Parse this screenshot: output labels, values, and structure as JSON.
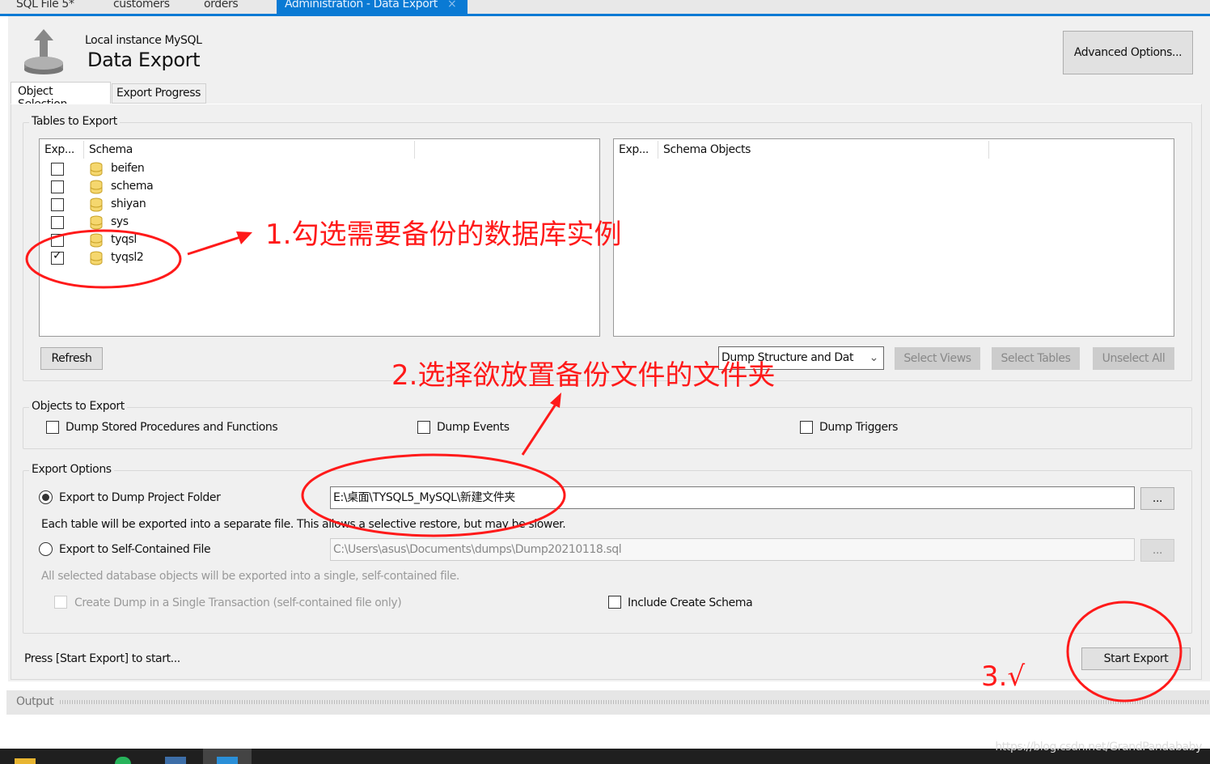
{
  "tabs": [
    {
      "label": "SQL File 5*"
    },
    {
      "label": "customers"
    },
    {
      "label": "orders"
    },
    {
      "label": "Administration - Data Export",
      "close": "×"
    }
  ],
  "header": {
    "subtitle": "Local instance MySQL",
    "title": "Data Export",
    "advanced_button": "Advanced Options..."
  },
  "subtabs": [
    "Object Selection",
    "Export Progress"
  ],
  "tables_to_export": {
    "label": "Tables to Export",
    "left_columns": [
      "Exp...",
      "Schema"
    ],
    "schemas": [
      {
        "name": "beifen",
        "checked": false
      },
      {
        "name": "schema",
        "checked": false
      },
      {
        "name": "shiyan",
        "checked": false
      },
      {
        "name": "sys",
        "checked": false
      },
      {
        "name": "tyqsl",
        "checked": false
      },
      {
        "name": "tyqsl2",
        "checked": true
      }
    ],
    "right_columns": [
      "Exp...",
      "Schema Objects"
    ],
    "refresh_button": "Refresh",
    "dump_select": "Dump Structure and Dat",
    "select_views": "Select Views",
    "select_tables": "Select Tables",
    "unselect_all": "Unselect All"
  },
  "objects_to_export": {
    "label": "Objects to Export",
    "items": [
      "Dump Stored Procedures and Functions",
      "Dump Events",
      "Dump Triggers"
    ]
  },
  "export_options": {
    "label": "Export Options",
    "folder_radio": "Export to Dump Project Folder",
    "folder_path": "E:\\桌面\\TYSQL5_MySQL\\新建文件夹",
    "browse": "...",
    "folder_desc": "Each table will be exported into a separate file. This allows a selective restore, but may be slower.",
    "file_radio": "Export to Self-Contained File",
    "file_path": "C:\\Users\\asus\\Documents\\dumps\\Dump20210118.sql",
    "file_desc": "All selected database objects will be exported into a single, self-contained file.",
    "single_transaction": "Create Dump in a Single Transaction (self-contained file only)",
    "include_schema": "Include Create Schema"
  },
  "status": "Press [Start Export] to start...",
  "start_button": "Start Export",
  "output_label": "Output",
  "annotations": {
    "step1": "1.勾选需要备份的数据库实例",
    "step2": "2.选择欲放置备份文件的文件夹",
    "step3": "3.√",
    "color": "#ff1a1a"
  },
  "watermark": "https://blog.csdn.net/GrandPandababy"
}
